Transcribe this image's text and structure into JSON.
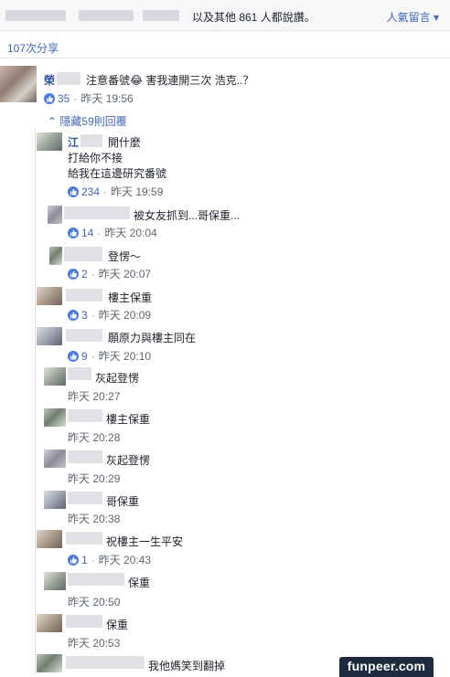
{
  "header": {
    "likes_summary": "以及其他 861 人都說讚。",
    "top_comments_link": "人氣留言 ▾"
  },
  "shares": {
    "label": "107次分享"
  },
  "main_comment": {
    "name_prefix": "榮",
    "text_before": "注意番號",
    "emoji": "😂",
    "text_after": "害我連開三次 浩克..？",
    "likes": "35",
    "time": "昨天 19:56"
  },
  "replies_toggle": "隱藏59則回覆",
  "replies": [
    {
      "name_prefix": "江",
      "text": "開什麼",
      "text2": "打給你不接",
      "text3": "給我在這邊研究番號",
      "likes": "234",
      "time": "昨天 19:59"
    },
    {
      "text": "被女友抓到...哥保重...",
      "likes": "14",
      "time": "昨天 20:04"
    },
    {
      "text": "登愣～",
      "likes": "2",
      "time": "昨天 20:07"
    },
    {
      "text": "樓主保重",
      "likes": "3",
      "time": "昨天 20:09"
    },
    {
      "text": "願原力與樓主同在",
      "likes": "9",
      "time": "昨天 20:10"
    },
    {
      "text": "灰起登愣",
      "time": "昨天 20:27"
    },
    {
      "text": "樓主保重",
      "time": "昨天 20:28"
    },
    {
      "text": "灰起登愣",
      "time": "昨天 20:29"
    },
    {
      "text": "哥保重",
      "time": "昨天 20:38"
    },
    {
      "text": "祝樓主一生平安",
      "likes": "1",
      "time": "昨天 20:43"
    },
    {
      "text": "保重",
      "time": "昨天 20:50"
    },
    {
      "text": "保重",
      "time": "昨天 20:53"
    },
    {
      "text": "我他媽笑到翻掉"
    }
  ],
  "watermark": "funpeer.com",
  "colors": {
    "link": "#4267b2",
    "like_blue": "#4a7bd9",
    "meta_gray": "#606770",
    "text": "#1d2129"
  }
}
